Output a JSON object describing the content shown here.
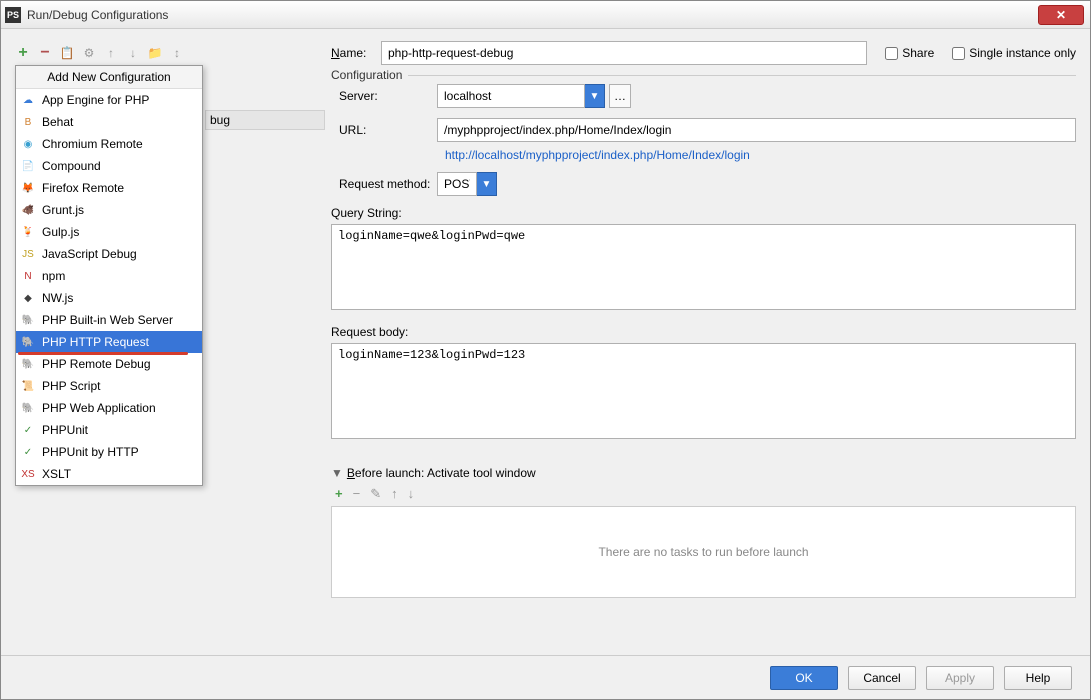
{
  "window": {
    "title": "Run/Debug Configurations"
  },
  "popup": {
    "header": "Add New Configuration",
    "items": [
      {
        "label": "App Engine for PHP",
        "ic": "☁",
        "c": "#3b7dd8"
      },
      {
        "label": "Behat",
        "ic": "B",
        "c": "#d08030"
      },
      {
        "label": "Chromium Remote",
        "ic": "◉",
        "c": "#39a0d0"
      },
      {
        "label": "Compound",
        "ic": "📄",
        "c": "#c09040"
      },
      {
        "label": "Firefox Remote",
        "ic": "🦊",
        "c": "#e06020"
      },
      {
        "label": "Grunt.js",
        "ic": "🐗",
        "c": "#b04020"
      },
      {
        "label": "Gulp.js",
        "ic": "🍹",
        "c": "#d03040"
      },
      {
        "label": "JavaScript Debug",
        "ic": "JS",
        "c": "#c0a020"
      },
      {
        "label": "npm",
        "ic": "N",
        "c": "#c03030"
      },
      {
        "label": "NW.js",
        "ic": "◆",
        "c": "#404040"
      },
      {
        "label": "PHP Built-in Web Server",
        "ic": "🐘",
        "c": "#7070b0"
      },
      {
        "label": "PHP HTTP Request",
        "ic": "🐘",
        "c": "#7070b0",
        "selected": true,
        "redline": true
      },
      {
        "label": "PHP Remote Debug",
        "ic": "🐘",
        "c": "#7070b0"
      },
      {
        "label": "PHP Script",
        "ic": "📜",
        "c": "#7070b0"
      },
      {
        "label": "PHP Web Application",
        "ic": "🐘",
        "c": "#7070b0"
      },
      {
        "label": "PHPUnit",
        "ic": "✓",
        "c": "#409040"
      },
      {
        "label": "PHPUnit by HTTP",
        "ic": "✓",
        "c": "#409040"
      },
      {
        "label": "XSLT",
        "ic": "XS",
        "c": "#c03030"
      }
    ]
  },
  "bgitem": "bug",
  "name": {
    "label": "Name:",
    "value": "php-http-request-debug"
  },
  "share": "Share",
  "single": "Single instance only",
  "config": {
    "legend": "Configuration",
    "server": {
      "label": "Server:",
      "value": "localhost"
    },
    "url": {
      "label": "URL:",
      "value": "/myphpproject/index.php/Home/Index/login"
    },
    "full_url": "http://localhost/myphpproject/index.php/Home/Index/login",
    "method": {
      "label": "Request method:",
      "value": "POST"
    },
    "qs": {
      "label": "Query String:",
      "value": "loginName=qwe&loginPwd=qwe"
    },
    "body": {
      "label": "Request body:",
      "value": "loginName=123&loginPwd=123"
    }
  },
  "before": {
    "label": "Before launch: Activate tool window",
    "empty": "There are no tasks to run before launch"
  },
  "footer": {
    "ok": "OK",
    "cancel": "Cancel",
    "apply": "Apply",
    "help": "Help"
  }
}
